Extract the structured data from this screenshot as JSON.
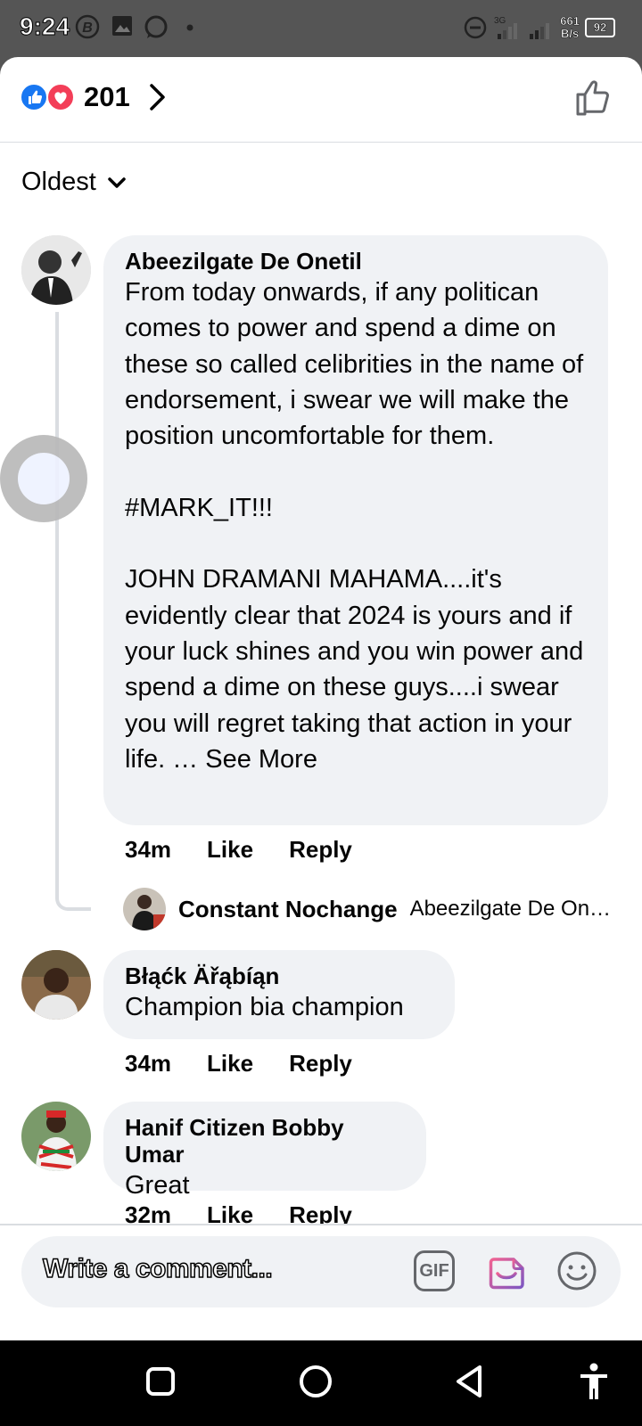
{
  "status_bar": {
    "time": "9:24",
    "network_type": "3G",
    "net_speed_value": "661",
    "net_speed_unit": "B/s",
    "battery": "92"
  },
  "reactions": {
    "count": "201",
    "types": [
      "like",
      "love"
    ]
  },
  "sort": {
    "label": "Oldest"
  },
  "comments": [
    {
      "author": "Abeezilgate De Onetil",
      "text": "From today onwards, if any politican comes to power and spend a dime on these so called celibrities in the name of endorsement, i swear we will make the position uncomfortable for them.\n\n#MARK_IT!!!\n\nJOHN DRAMANI MAHAMA....it's evidently clear that 2024 is yours and if your luck shines and you win power and spend a dime on these guys....i swear you will regret taking that action in your life. … See More",
      "time": "34m",
      "like_label": "Like",
      "reply_label": "Reply",
      "reply_preview": {
        "author": "Constant Nochange",
        "snippet": "Abeezilgate De On…"
      }
    },
    {
      "author": "Błąćk Äřąbíąn",
      "text": "Champion bia champion",
      "time": "34m",
      "like_label": "Like",
      "reply_label": "Reply"
    },
    {
      "author": "Hanif Citizen Bobby Umar",
      "text": "Great",
      "time": "32m",
      "like_label": "Like",
      "reply_label": "Reply"
    }
  ],
  "composer": {
    "placeholder": "Write a comment...",
    "gif_label": "GIF"
  },
  "colors": {
    "like_blue": "#1877f2",
    "love_red": "#f33e58",
    "bubble_bg": "#f0f2f5",
    "sticker_purple": "#a33fd1"
  }
}
